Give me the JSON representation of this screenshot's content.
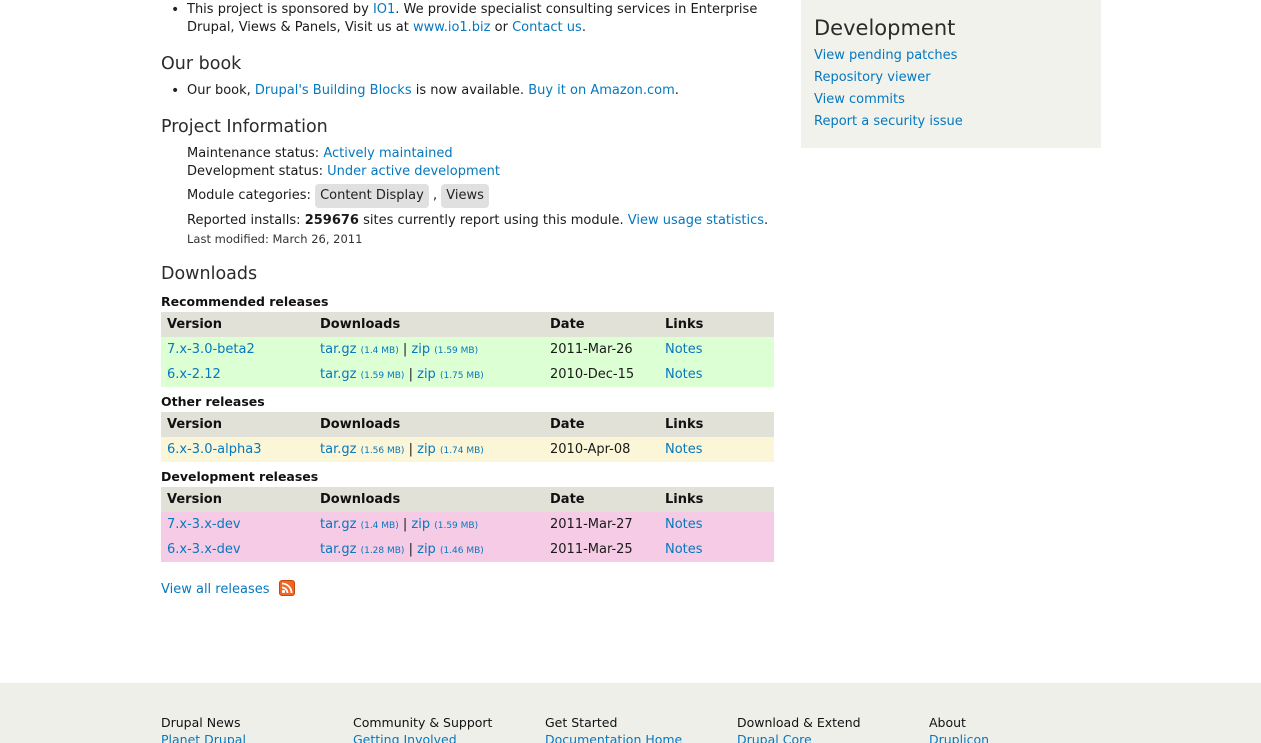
{
  "sponsor": {
    "text1": "This project is sponsored by ",
    "io1_link": "IO1",
    "text2": ". We provide specialist consulting services in Enterprise",
    "text3": "Drupal, Views & Panels, Visit us at ",
    "site_link": "www.io1.biz",
    "text4": " or ",
    "contact_link": "Contact us",
    "text5": "."
  },
  "book": {
    "heading": "Our book",
    "text1": "Our book, ",
    "book_link": "Drupal's Building Blocks",
    "text2": " is now available. ",
    "amazon_link": "Buy it on Amazon.com",
    "text3": "."
  },
  "project_info": {
    "heading": "Project Information",
    "maintenance_label": "Maintenance status: ",
    "maintenance_value": "Actively maintained",
    "development_label": "Development status: ",
    "development_value": "Under active development",
    "categories_label": "Module categories: ",
    "categories": [
      "Content Display",
      "Views"
    ],
    "categories_sep": " ,",
    "installs_label": "Reported installs: ",
    "installs_count": "259676",
    "installs_text": " sites currently report using this module. ",
    "usage_link": "View usage statistics",
    "installs_end": ".",
    "last_modified": "Last modified: March 26, 2011"
  },
  "downloads": {
    "heading": "Downloads",
    "columns": [
      "Version",
      "Downloads",
      "Date",
      "Links"
    ],
    "separator": "|",
    "recommended": {
      "title": "Recommended releases",
      "rows": [
        {
          "version": "7.x-3.0-beta2",
          "tar": "tar.gz",
          "tar_size": "(1.4 MB)",
          "zip": "zip",
          "zip_size": "(1.59 MB)",
          "date": "2011-Mar-26",
          "notes": "Notes"
        },
        {
          "version": "6.x-2.12",
          "tar": "tar.gz",
          "tar_size": "(1.59 MB)",
          "zip": "zip",
          "zip_size": "(1.75 MB)",
          "date": "2010-Dec-15",
          "notes": "Notes"
        }
      ]
    },
    "other": {
      "title": "Other releases",
      "rows": [
        {
          "version": "6.x-3.0-alpha3",
          "tar": "tar.gz",
          "tar_size": "(1.56 MB)",
          "zip": "zip",
          "zip_size": "(1.74 MB)",
          "date": "2010-Apr-08",
          "notes": "Notes"
        }
      ]
    },
    "development": {
      "title": "Development releases",
      "rows": [
        {
          "version": "7.x-3.x-dev",
          "tar": "tar.gz",
          "tar_size": "(1.4 MB)",
          "zip": "zip",
          "zip_size": "(1.59 MB)",
          "date": "2011-Mar-27",
          "notes": "Notes"
        },
        {
          "version": "6.x-3.x-dev",
          "tar": "tar.gz",
          "tar_size": "(1.28 MB)",
          "zip": "zip",
          "zip_size": "(1.46 MB)",
          "date": "2011-Mar-25",
          "notes": "Notes"
        }
      ]
    },
    "view_all": "View all releases",
    "rss_icon": "rss-feed-icon"
  },
  "sidebar": {
    "heading": "Development",
    "links": [
      "View pending patches",
      "Repository viewer",
      "View commits",
      "Report a security issue"
    ]
  },
  "footer": {
    "columns": [
      {
        "title": "Drupal News",
        "link": "Planet Drupal"
      },
      {
        "title": "Community & Support",
        "link": "Getting Involved"
      },
      {
        "title": "Get Started",
        "link": "Documentation Home"
      },
      {
        "title": "Download & Extend",
        "link": "Drupal Core"
      },
      {
        "title": "About",
        "link": "Druplicon"
      }
    ]
  },
  "colors": {
    "link": "#0678be",
    "recommended_row": "#ddffd4",
    "other_row": "#fbf6d8",
    "dev_row": "#f5cbe5",
    "table_header": "#e1e1d8",
    "sidebar_bg": "#f2f2ec",
    "footer_bg": "#efefea"
  }
}
